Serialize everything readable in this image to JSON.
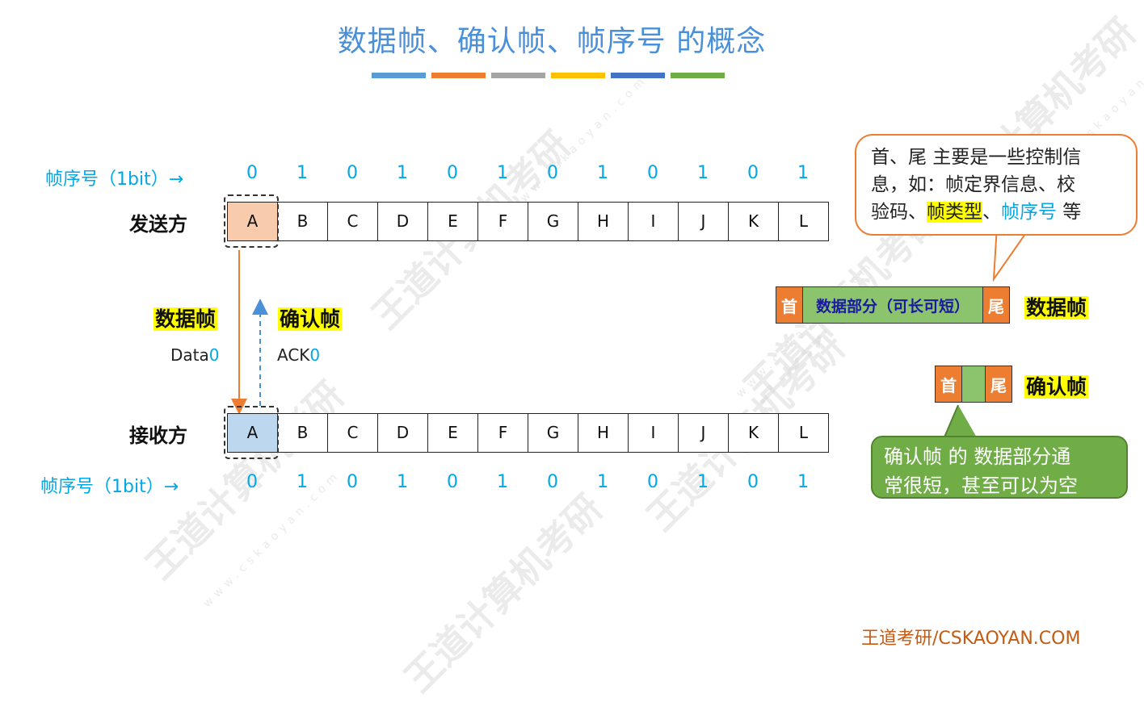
{
  "title": "数据帧、确认帧、帧序号 的概念",
  "colors": {
    "stripes": [
      "#5b9bd5",
      "#ed7d31",
      "#a5a5a5",
      "#ffc000",
      "#4472c4",
      "#70ad47"
    ],
    "sender_highlight": "#f8cbad",
    "receiver_highlight": "#bdd7ee",
    "accent_blue": "#00a8e8",
    "orange": "#ed7d31",
    "green": "#70ad47"
  },
  "seq_label": "帧序号（1bit）→",
  "seq_numbers": [
    "0",
    "1",
    "0",
    "1",
    "0",
    "1",
    "0",
    "1",
    "0",
    "1",
    "0",
    "1"
  ],
  "sender": {
    "label": "发送方",
    "frames": [
      "A",
      "B",
      "C",
      "D",
      "E",
      "F",
      "G",
      "H",
      "I",
      "J",
      "K",
      "L"
    ]
  },
  "receiver": {
    "label": "接收方",
    "frames": [
      "A",
      "B",
      "C",
      "D",
      "E",
      "F",
      "G",
      "H",
      "I",
      "J",
      "K",
      "L"
    ]
  },
  "data_frame": {
    "label": "数据帧",
    "name_text": "Data",
    "seq": "0"
  },
  "ack_frame": {
    "label": "确认帧",
    "name_text": "ACK",
    "seq": "0"
  },
  "top_callout": {
    "line1": "首、尾 主要是一些控制信",
    "line2": "息，如：帧定界信息、校",
    "line3_pre": "验码、",
    "line3_highlight": "帧类型",
    "line3_mid": "、",
    "line3_blue": "帧序号",
    "line3_post": " 等"
  },
  "data_frame_struct": {
    "head": "首",
    "body": "数据部分（可长可短）",
    "tail": "尾",
    "label": "数据帧"
  },
  "ack_frame_struct": {
    "head": "首",
    "body": "",
    "tail": "尾",
    "label": "确认帧"
  },
  "bottom_callout": {
    "line1": "确认帧 的 数据部分通",
    "line2": "常很短，甚至可以为空"
  },
  "footer": "王道考研/CSKAOYAN.COM",
  "watermark": {
    "text": "王道计算机考研",
    "url": "www.cskaoyan.com"
  }
}
